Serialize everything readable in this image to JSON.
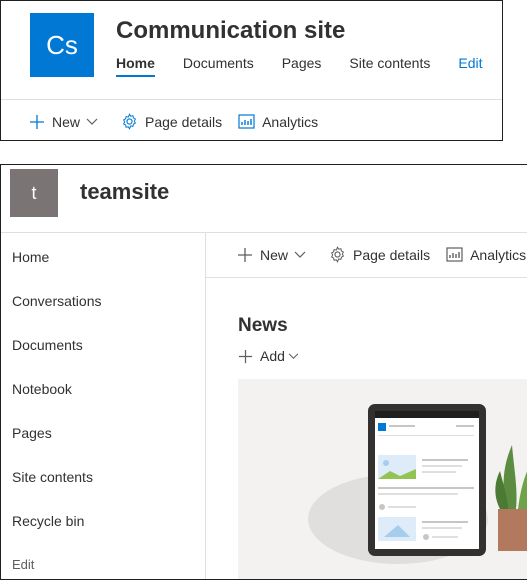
{
  "communication_site": {
    "logo_initials": "Cs",
    "logo_color": "#0078d4",
    "title": "Communication site",
    "nav": [
      {
        "label": "Home",
        "active": true
      },
      {
        "label": "Documents",
        "active": false
      },
      {
        "label": "Pages",
        "active": false
      },
      {
        "label": "Site contents",
        "active": false
      }
    ],
    "edit_label": "Edit",
    "commandbar": {
      "new_label": "New",
      "page_details_label": "Page details",
      "analytics_label": "Analytics"
    }
  },
  "team_site": {
    "logo_initial": "t",
    "logo_color": "#7a7574",
    "title": "teamsite",
    "leftnav": [
      "Home",
      "Conversations",
      "Documents",
      "Notebook",
      "Pages",
      "Site contents",
      "Recycle bin"
    ],
    "leftnav_edit": "Edit",
    "commandbar": {
      "new_label": "New",
      "page_details_label": "Page details",
      "analytics_label": "Analytics"
    },
    "news": {
      "title": "News",
      "add_label": "Add"
    }
  },
  "colors": {
    "accent": "#0078d4",
    "text": "#323130",
    "divider": "#e1dfdd"
  }
}
